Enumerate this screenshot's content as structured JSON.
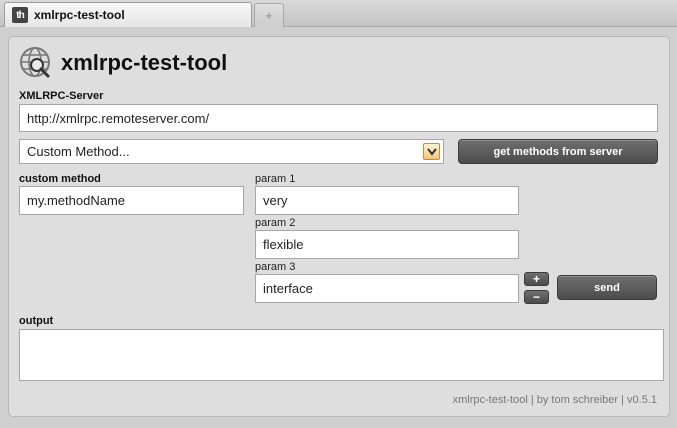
{
  "tabs": [
    {
      "label": "xmlrpc-test-tool",
      "favicon": "th"
    }
  ],
  "new_tab_symbol": "+",
  "app": {
    "title": "xmlrpc-test-tool"
  },
  "server": {
    "label": "XMLRPC-Server",
    "value": "http://xmlrpc.remoteserver.com/"
  },
  "method_select": {
    "selected": "Custom Method..."
  },
  "get_methods_button": "get methods from server",
  "custom_method": {
    "label": "custom method",
    "value": "my.methodName"
  },
  "params": [
    {
      "label": "param 1",
      "value": "very"
    },
    {
      "label": "param 2",
      "value": "flexible"
    },
    {
      "label": "param 3",
      "value": "interface"
    }
  ],
  "add_param_symbol": "+",
  "remove_param_symbol": "−",
  "send_button": "send",
  "output": {
    "label": "output",
    "value": ""
  },
  "footer": "xmlrpc-test-tool | by tom schreiber | v0.5.1",
  "colors": {
    "button": "#5a5a5a",
    "select_arrow_border": "#d08a2a",
    "background": "#dedede"
  }
}
